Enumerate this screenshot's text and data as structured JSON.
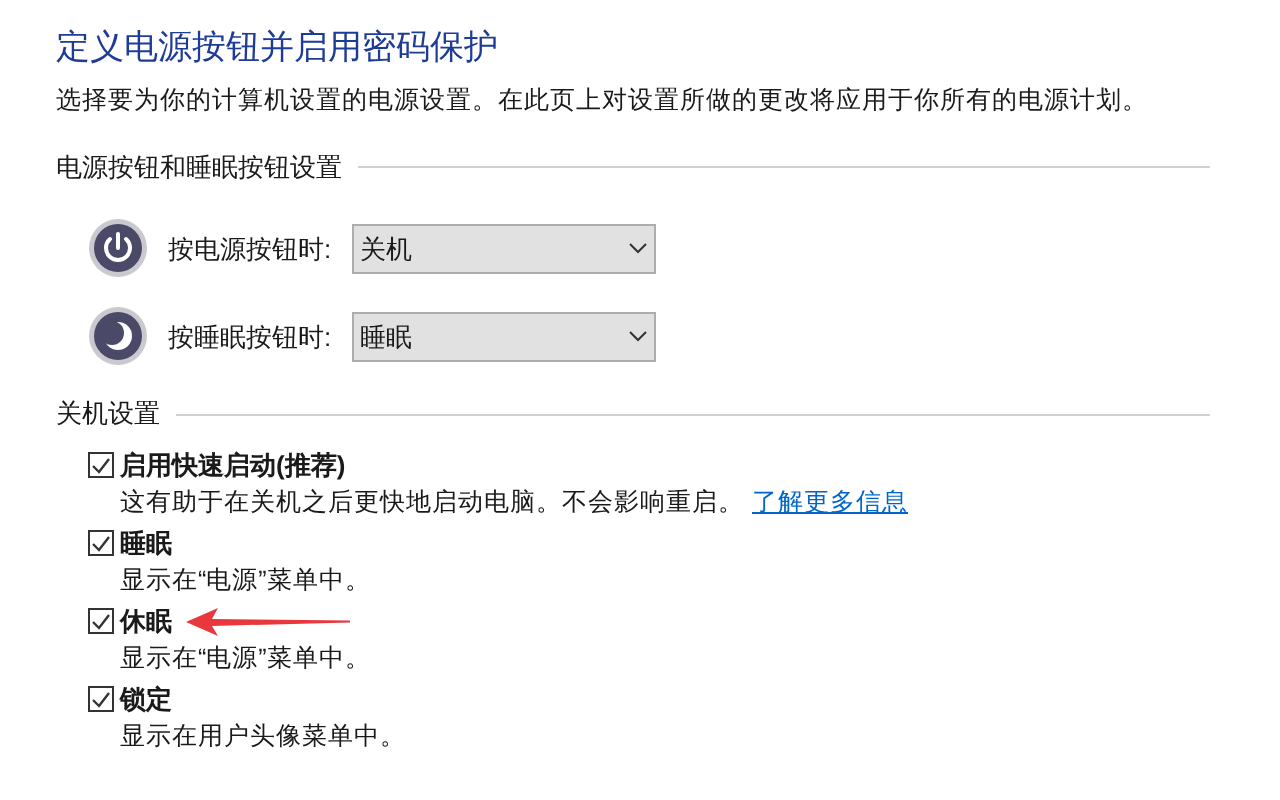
{
  "title": "定义电源按钮并启用密码保护",
  "description": "选择要为你的计算机设置的电源设置。在此页上对设置所做的更改将应用于你所有的电源计划。",
  "button_section": {
    "heading": "电源按钮和睡眠按钮设置",
    "rows": [
      {
        "kind": "power",
        "label": "按电源按钮时:",
        "value": "关机"
      },
      {
        "kind": "sleep",
        "label": "按睡眠按钮时:",
        "value": "睡眠"
      }
    ]
  },
  "shutdown_section": {
    "heading": "关机设置",
    "options": [
      {
        "label": "启用快速启动(推荐)",
        "checked": true,
        "description": "这有助于在关机之后更快地启动电脑。不会影响重启。",
        "link": "了解更多信息"
      },
      {
        "label": "睡眠",
        "checked": true,
        "description": "显示在“电源”菜单中。"
      },
      {
        "label": "休眠",
        "checked": true,
        "description": "显示在“电源”菜单中。",
        "annotated": true
      },
      {
        "label": "锁定",
        "checked": true,
        "description": "显示在用户头像菜单中。"
      }
    ]
  }
}
